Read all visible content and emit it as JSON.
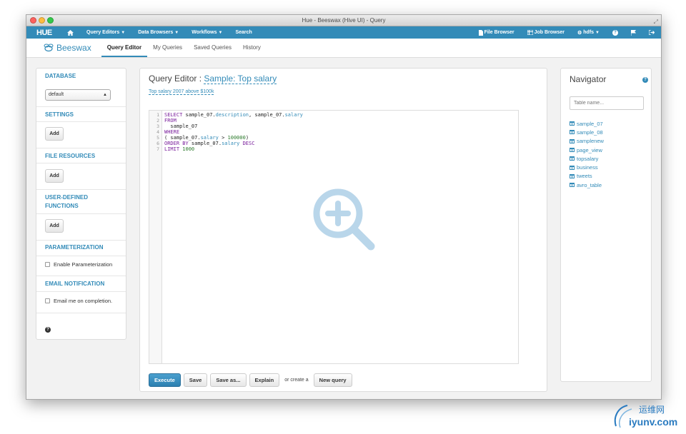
{
  "window": {
    "title": "Hue - Beeswax (Hive UI) - Query"
  },
  "topnav": {
    "logo": "HUE",
    "left_items": [
      {
        "label": "",
        "icon": "home-icon"
      },
      {
        "label": "Query Editors",
        "caret": true
      },
      {
        "label": "Data Browsers",
        "caret": true
      },
      {
        "label": "Workflows",
        "caret": true
      },
      {
        "label": "Search",
        "caret": false
      }
    ],
    "right_items": {
      "file_browser": "File Browser",
      "job_browser": "Job Browser",
      "user": "hdfs"
    }
  },
  "appbar": {
    "brand": "Beeswax",
    "tabs": [
      {
        "label": "Query Editor",
        "active": true
      },
      {
        "label": "My Queries",
        "active": false
      },
      {
        "label": "Saved Queries",
        "active": false
      },
      {
        "label": "History",
        "active": false
      }
    ]
  },
  "sidebar": {
    "database_title": "DATABASE",
    "database_value": "default",
    "settings_title": "SETTINGS",
    "file_resources_title": "FILE RESOURCES",
    "udf_title_line1": "USER-DEFINED",
    "udf_title_line2": "FUNCTIONS",
    "add_label": "Add",
    "parameterization_title": "PARAMETERIZATION",
    "enable_param_label": "Enable Parameterization",
    "email_title": "EMAIL NOTIFICATION",
    "email_label": "Email me on completion."
  },
  "editor": {
    "title_prefix": "Query Editor :",
    "query_name": "Sample: Top salary",
    "query_description": "Top salary 2007 above $100k",
    "line_numbers": [
      "1",
      "2",
      "3",
      "4",
      "5",
      "6",
      "7"
    ],
    "code": {
      "l1_kw": "SELECT",
      "l1_a": " sample_07.",
      "l1_f1": "description",
      "l1_b": ", sample_07.",
      "l1_f2": "salary",
      "l2_kw": "FROM",
      "l3": "  sample_07",
      "l4_kw": "WHERE",
      "l5_a": "( sample_07.",
      "l5_f": "salary",
      "l5_b": " > ",
      "l5_n": "100000",
      "l5_c": ")",
      "l6_kw1": "ORDER BY",
      "l6_a": " sample_07.",
      "l6_f": "salary",
      "l6_kw2": " DESC",
      "l7_kw": "LIMIT",
      "l7_n": " 1000"
    }
  },
  "actions": {
    "execute": "Execute",
    "save": "Save",
    "save_as": "Save as...",
    "explain": "Explain",
    "or_create": "or create a",
    "new_query": "New query"
  },
  "navigator": {
    "title": "Navigator",
    "placeholder": "Table name...",
    "tables": [
      "sample_07",
      "sample_08",
      "samplenew",
      "page_view",
      "topsalary",
      "business",
      "tweets",
      "avro_table"
    ]
  },
  "watermark": {
    "cn": "运维网",
    "en": "iyunv.com"
  },
  "colors": {
    "accent": "#338bb8",
    "nav_bg": "#338bb8",
    "primary_button": "#2c7fb0"
  }
}
